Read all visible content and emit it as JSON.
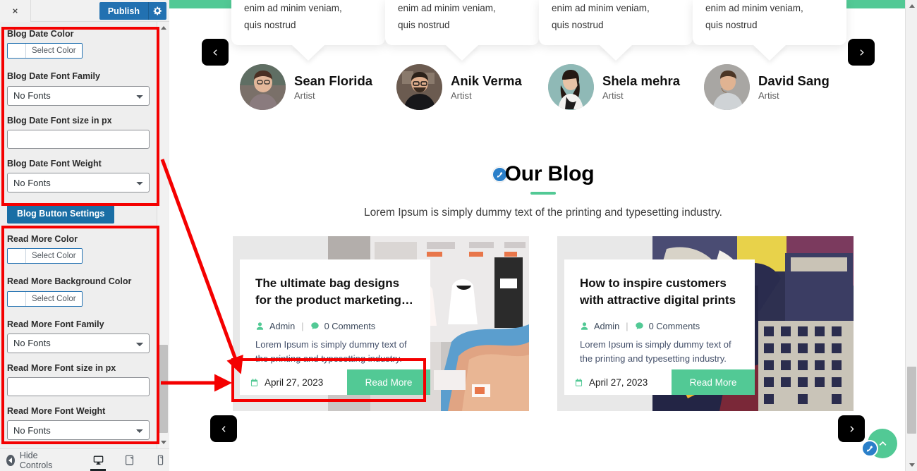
{
  "customizer": {
    "close_icon": "close-icon",
    "publish_label": "Publish",
    "gear_icon": "gear-icon",
    "controls": [
      {
        "label": "Blog Date Color",
        "type": "color",
        "value": "",
        "button_label": "Select Color"
      },
      {
        "label": "Blog Date Font Family",
        "type": "select",
        "value": "No Fonts"
      },
      {
        "label": "Blog Date Font size in px",
        "type": "text",
        "value": "",
        "placeholder": ""
      },
      {
        "label": "Blog Date Font Weight",
        "type": "select",
        "value": "No Fonts"
      }
    ],
    "section_button": "Blog Button Settings",
    "controls2": [
      {
        "label": "Read More Color",
        "type": "color",
        "value": "",
        "button_label": "Select Color"
      },
      {
        "label": "Read More Background Color",
        "type": "color",
        "value": "",
        "button_label": "Select Color"
      },
      {
        "label": "Read More Font Family",
        "type": "select",
        "value": "No Fonts"
      },
      {
        "label": "Read More Font size in px",
        "type": "text",
        "value": "",
        "placeholder": ""
      },
      {
        "label": "Read More Font Weight",
        "type": "select",
        "value": "No Fonts"
      }
    ],
    "footer": {
      "hide_controls_label": "Hide Controls",
      "devices": [
        "desktop-icon",
        "tablet-icon",
        "mobile-icon"
      ],
      "active_device": "desktop-icon"
    },
    "accent_blue": "#2271b1",
    "section_btn_blue": "#1a6ea5"
  },
  "preview": {
    "team": {
      "bubble_text_line1": "enim ad minim veniam,",
      "bubble_text_line2": "quis nostrud",
      "members": [
        {
          "name": "Sean Florida",
          "role": "Artist"
        },
        {
          "name": "Anik Verma",
          "role": "Artist"
        },
        {
          "name": "Shela mehra",
          "role": "Artist"
        },
        {
          "name": "David Sang",
          "role": "Artist"
        }
      ],
      "prev_icon": "chevron-left-icon",
      "next_icon": "chevron-right-icon"
    },
    "blog": {
      "edit_icon": "edit-pencil-icon",
      "title": "Our Blog",
      "subtitle": "Lorem Ipsum is simply dummy text of the printing and typesetting industry.",
      "accent_green": "#52c995",
      "cards": [
        {
          "title": "The ultimate bag designs for the product marketing…",
          "author": "Admin",
          "comments": "0 Comments",
          "excerpt": "Lorem Ipsum is simply dummy text of the printing and typesetting industry.",
          "date": "April 27, 2023",
          "read_more": "Read More",
          "author_icon": "user-icon",
          "comment_icon": "comment-icon",
          "date_icon": "calendar-icon"
        },
        {
          "title": "How to inspire customers with attractive digital prints",
          "author": "Admin",
          "comments": "0 Comments",
          "excerpt": "Lorem Ipsum is simply dummy text of the printing and typesetting industry.",
          "date": "April 27, 2023",
          "read_more": "Read More",
          "author_icon": "user-icon",
          "comment_icon": "comment-icon",
          "date_icon": "calendar-icon"
        }
      ],
      "prev_icon": "chevron-left-icon",
      "next_icon": "chevron-right-icon"
    },
    "to_top_icon": "chevron-up-icon",
    "float_edit_icon": "edit-pencil-icon"
  },
  "annotations": {
    "highlight_color": "#f40000"
  }
}
